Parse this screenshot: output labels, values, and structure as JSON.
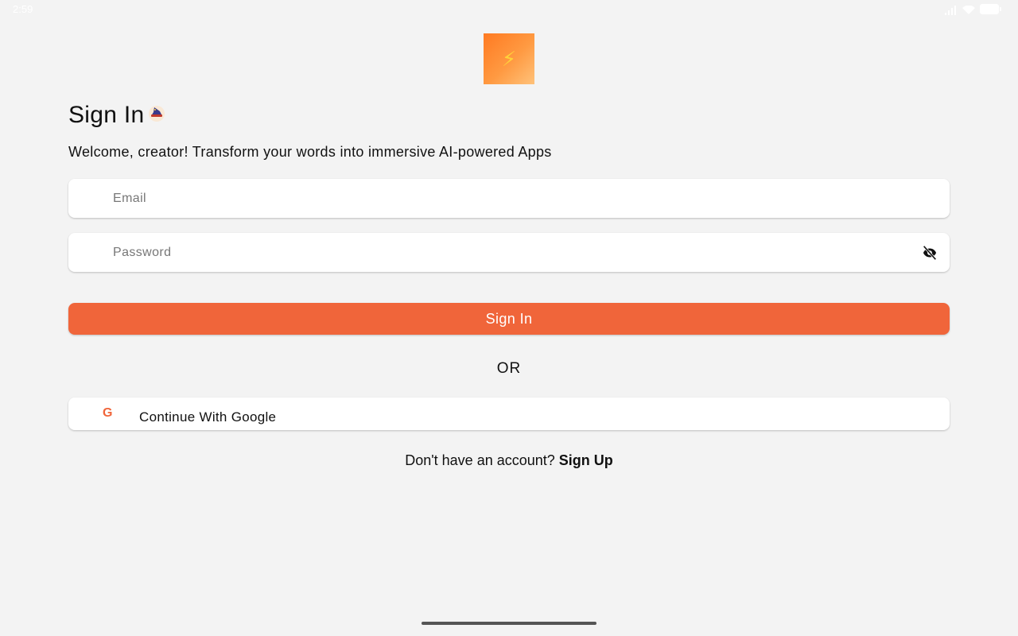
{
  "status_bar": {
    "time": "2:59"
  },
  "logo": {
    "icon": "lightning-bolt-icon",
    "glyph": "⚡",
    "gradient_start": "#ff7a22",
    "gradient_end": "#ffc27a"
  },
  "header": {
    "title": "Sign In",
    "title_emoji_icon": "wizard-hat-emoji-icon",
    "subtitle": "Welcome, creator! Transform your words into immersive AI-powered Apps"
  },
  "form": {
    "email": {
      "placeholder": "Email",
      "value": ""
    },
    "password": {
      "placeholder": "Password",
      "value": "",
      "toggle_icon": "eye-off-icon"
    },
    "submit_label": "Sign In"
  },
  "divider": {
    "label": "OR"
  },
  "google": {
    "icon": "google-g-icon",
    "icon_glyph": "G",
    "label": "Continue With Google"
  },
  "footer": {
    "prompt": "Don't have an account? ",
    "link": "Sign Up"
  },
  "colors": {
    "accent": "#f0653a",
    "background": "#f3f3f3",
    "card": "#ffffff",
    "text": "#111111"
  }
}
